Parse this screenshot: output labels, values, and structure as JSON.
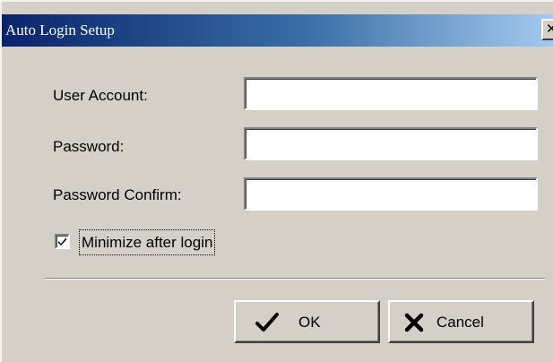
{
  "window": {
    "title": "Auto Login Setup",
    "close_glyph": "✕"
  },
  "form": {
    "user_account": {
      "label": "User Account:",
      "value": ""
    },
    "password": {
      "label": "Password:",
      "value": ""
    },
    "password_confirm": {
      "label": "Password Confirm:",
      "value": ""
    },
    "minimize_after_login": {
      "label": "Minimize after login",
      "checked": true
    }
  },
  "buttons": {
    "ok": {
      "label": "OK",
      "icon": "checkmark-icon"
    },
    "cancel": {
      "label": "Cancel",
      "icon": "x-icon"
    }
  },
  "colors": {
    "titlebar_start": "#0a246a",
    "titlebar_end": "#a6caf0",
    "dialog_background": "#d4d0c8"
  }
}
